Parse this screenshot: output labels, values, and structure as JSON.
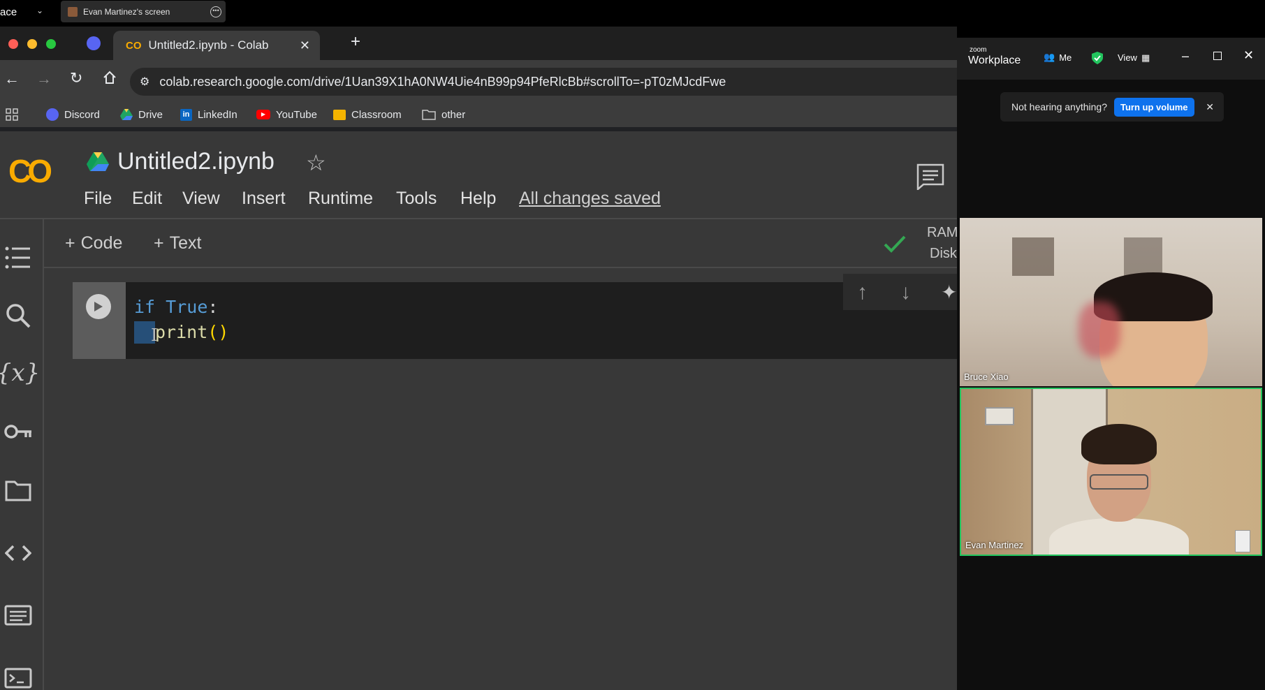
{
  "zoom_share": {
    "left_text": "ace",
    "share_title": "Evan Martinez's screen"
  },
  "browser": {
    "tab_title": "Untitled2.ipynb - Colab",
    "url": "colab.research.google.com/drive/1Uan39X1hA0NW4Uie4nB99p94PfeRlcBb#scrollTo=-pT0zMJcdFwe",
    "bookmarks": [
      {
        "label": "Discord",
        "icon": "discord-icon"
      },
      {
        "label": "Drive",
        "icon": "drive-icon"
      },
      {
        "label": "LinkedIn",
        "icon": "linkedin-icon"
      },
      {
        "label": "YouTube",
        "icon": "youtube-icon"
      },
      {
        "label": "Classroom",
        "icon": "classroom-icon"
      },
      {
        "label": "other",
        "icon": "folder-icon"
      }
    ]
  },
  "colab": {
    "logo": "CO",
    "notebook_title": "Untitled2.ipynb",
    "menu": [
      "File",
      "Edit",
      "View",
      "Insert",
      "Runtime",
      "Tools",
      "Help"
    ],
    "save_status": "All changes saved",
    "add_code": "Code",
    "add_text": "Text",
    "resources": {
      "ram": "RAM",
      "disk": "Disk"
    },
    "cell_code": {
      "line1_keyword": "if",
      "line1_value": "True",
      "line1_colon": ":",
      "line2_func": "print",
      "line2_parens": "()"
    }
  },
  "zoom": {
    "brand_small": "zoom",
    "brand": "Workplace",
    "meeting_label": "Me",
    "view_label": "View",
    "notice_text": "Not hearing anything?",
    "notice_button": "Turn up volume",
    "participants": [
      {
        "name": "Bruce Xiao"
      },
      {
        "name": "Evan Martinez"
      }
    ]
  },
  "colors": {
    "colab_bg": "#383838",
    "zoom_blue": "#0e72ed",
    "active_speaker": "#22c55e",
    "keyword_blue": "#569cd6",
    "builtin_yellow": "#dcdcaa"
  }
}
